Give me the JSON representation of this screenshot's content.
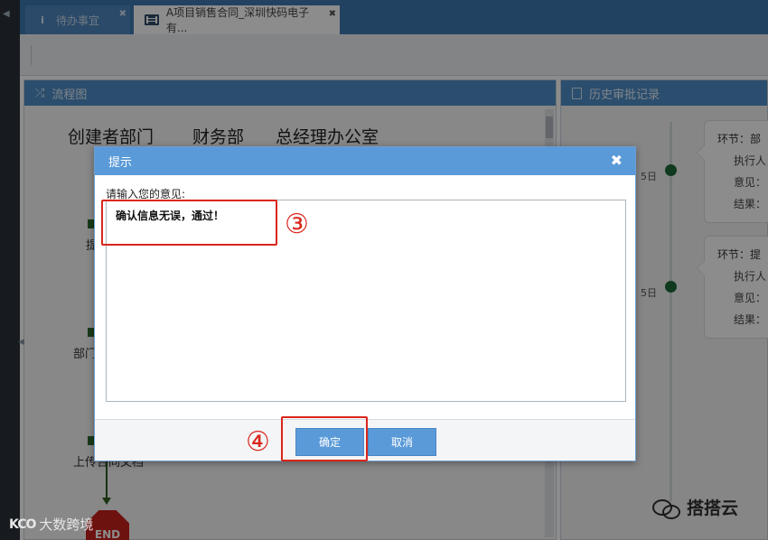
{
  "tabs": [
    {
      "label": "待办事宜",
      "icon": "info-icon"
    },
    {
      "label": "A项目销售合同_深圳快码电子有...",
      "icon": "form-icon"
    }
  ],
  "panels": {
    "flow": {
      "title": "流程图",
      "icon": "shuffle-icon",
      "lanes": [
        "创建者部门",
        "财务部",
        "总经理办公室"
      ],
      "node_fragments": [
        "提",
        "部门",
        "上传合同文档"
      ],
      "end_label": "END"
    },
    "history": {
      "title": "历史审批记录",
      "icon": "document-icon",
      "entries": [
        {
          "date": "5日",
          "step": "环节：部",
          "executor": "执行人",
          "opinion": "意见：",
          "result": "结果："
        },
        {
          "date": "5日",
          "step": "环节：提",
          "executor": "执行人",
          "opinion": "意见：",
          "result": "结果："
        }
      ]
    }
  },
  "dialog": {
    "title": "提示",
    "prompt": "请输入您的意见:",
    "opinion_value": "确认信息无误，通过！",
    "ok_label": "确定",
    "cancel_label": "取消"
  },
  "annotations": {
    "step3": "③",
    "step4": "④",
    "color": "#d9261c"
  },
  "watermarks": {
    "left_logo": "KCO",
    "left": "大数跨境",
    "right": "搭搭云"
  },
  "colors": {
    "header_blue": "#3f78b2",
    "panel_head": "#4f8ec9",
    "dialog_head": "#5a9ad8",
    "timeline_dot": "#1d6b3a",
    "end_red": "#c9211e"
  }
}
